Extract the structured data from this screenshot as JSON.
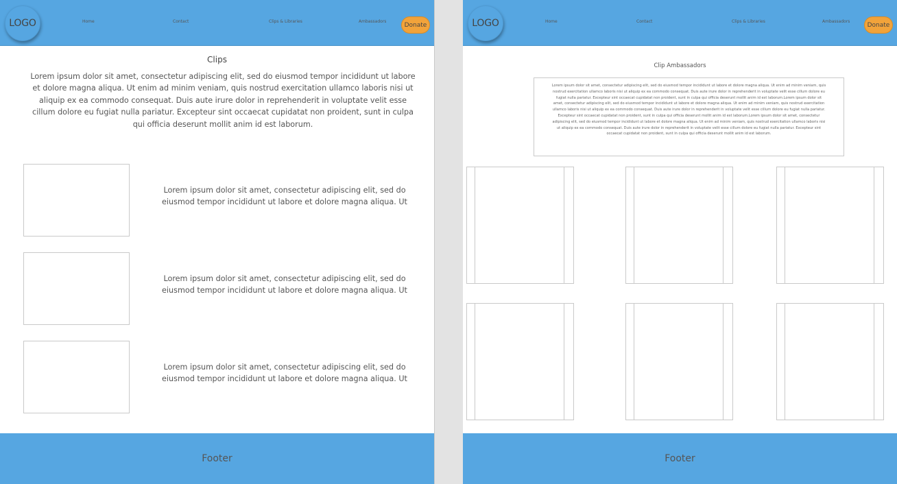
{
  "colors": {
    "header": "#56a6e1",
    "donate": "#f2a33a",
    "footer": "#56a6e1",
    "gutter": "#e3e3e3"
  },
  "left_page": {
    "header": {
      "logo": "LOGO",
      "nav": [
        "Home",
        "Contact",
        "Clips & Libraries",
        "Ambassadors"
      ],
      "donate": "Donate"
    },
    "title": "Clips",
    "intro": "Lorem ipsum dolor sit amet, consectetur adipiscing elit, sed do eiusmod tempor incididunt ut labore et dolore magna aliqua. Ut enim ad minim veniam, quis nostrud exercitation ullamco laboris nisi ut aliquip ex ea commodo consequat. Duis aute irure dolor in reprehenderit in voluptate velit esse cillum dolore eu fugiat nulla pariatur. Excepteur sint occaecat cupidatat non proident, sunt in culpa qui officia deserunt mollit anim id est laborum.",
    "clips": [
      {
        "text": "Lorem ipsum dolor sit amet, consectetur adipiscing elit, sed do eiusmod tempor incididunt ut labore et dolore magna aliqua. Ut"
      },
      {
        "text": "Lorem ipsum dolor sit amet, consectetur adipiscing elit, sed do eiusmod tempor incididunt ut labore et dolore magna aliqua. Ut"
      },
      {
        "text": "Lorem ipsum dolor sit amet, consectetur adipiscing elit, sed do eiusmod tempor incididunt ut labore et dolore magna aliqua. Ut"
      }
    ],
    "footer": "Footer"
  },
  "right_page": {
    "header": {
      "logo": "LOGO",
      "nav": [
        "Home",
        "Contact",
        "Clips & Libraries",
        "Ambassadors"
      ],
      "donate": "Donate"
    },
    "title": "Clip Ambassadors",
    "body": "Lorem ipsum dolor sit amet, consectetur adipiscing elit, sed do eiusmod tempor incididunt ut labore et dolore magna aliqua. Ut enim ad minim veniam, quis nostrud exercitation ullamco laboris nisi ut aliquip ex ea commodo consequat. Duis aute irure dolor in reprehenderit in voluptate velit esse cillum dolore eu fugiat nulla pariatur. Excepteur sint occaecat cupidatat non proident, sunt in culpa qui officia deserunt mollit anim id est laborum.Lorem ipsum dolor sit amet, consectetur adipiscing elit, sed do eiusmod tempor incididunt ut labore et dolore magna aliqua. Ut enim ad minim veniam, quis nostrud exercitation ullamco laboris nisi ut aliquip ex ea commodo consequat. Duis aute irure dolor in reprehenderit in voluptate velit esse cillum dolore eu fugiat nulla pariatur. Excepteur sint occaecat cupidatat non proident, sunt in culpa qui officia deserunt mollit anim id est laborum.Lorem ipsum dolor sit amet, consectetur adipiscing elit, sed do eiusmod tempor incididunt ut labore et dolore magna aliqua. Ut enim ad minim veniam, quis nostrud exercitation ullamco laboris nisi ut aliquip ex ea commodo consequat. Duis aute irure dolor in reprehenderit in voluptate velit esse cillum dolore eu fugiat nulla pariatur. Excepteur sint occaecat cupidatat non proident, sunt in culpa qui officia deserunt mollit anim id est laborum.",
    "footer": "Footer"
  }
}
